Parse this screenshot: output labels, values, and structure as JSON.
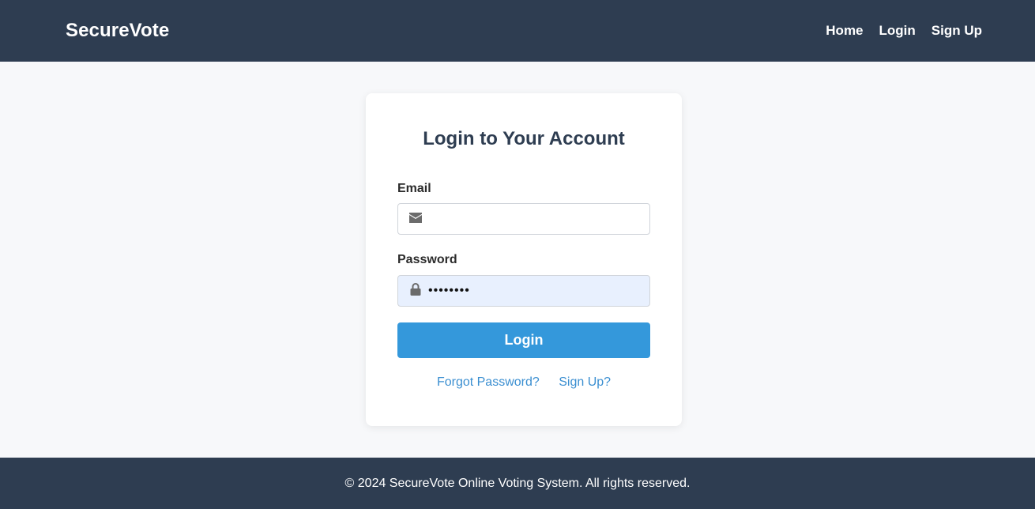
{
  "nav": {
    "brand": "SecureVote",
    "links": [
      "Home",
      "Login",
      "Sign Up"
    ]
  },
  "form": {
    "title": "Login to Your Account",
    "email_label": "Email",
    "email_value": "",
    "email_icon": "envelope-icon",
    "password_label": "Password",
    "password_value": "••••••••",
    "password_icon": "lock-icon",
    "submit_label": "Login",
    "forgot_link": "Forgot Password?",
    "signup_link": "Sign Up?"
  },
  "footer": {
    "text": "© 2024 SecureVote Online Voting System. All rights reserved."
  },
  "colors": {
    "navbar": "#2e3d51",
    "primary_button": "#3498db",
    "link": "#3b8fd1",
    "autofill_bg": "#e8f0fe"
  }
}
